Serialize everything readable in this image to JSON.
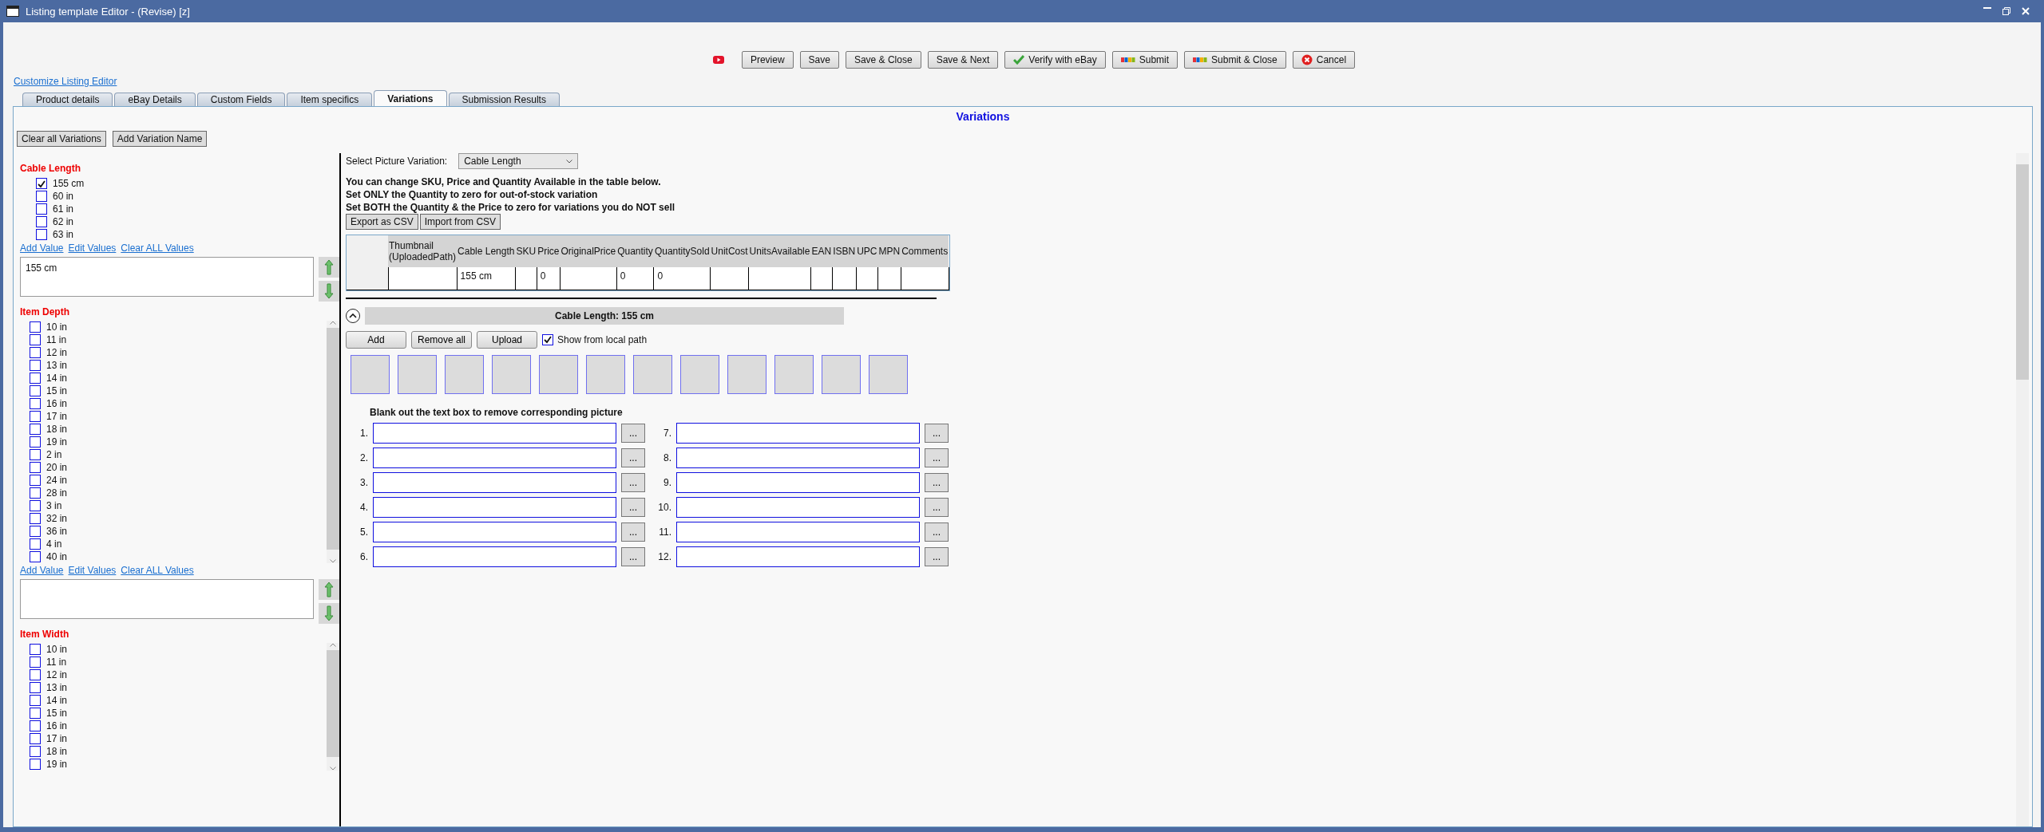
{
  "window": {
    "title": "Listing template Editor - (Revise) [z]"
  },
  "toolbar": [
    {
      "kind": "video"
    },
    {
      "kind": "plain",
      "label": "Preview"
    },
    {
      "kind": "plain",
      "label": "Save"
    },
    {
      "kind": "plain",
      "label": "Save & Close"
    },
    {
      "kind": "plain",
      "label": "Save & Next"
    },
    {
      "kind": "verify",
      "label": "Verify with eBay"
    },
    {
      "kind": "ebay",
      "label": "Submit"
    },
    {
      "kind": "ebay",
      "label": "Submit & Close"
    },
    {
      "kind": "cancel",
      "label": "Cancel"
    }
  ],
  "customize_link": "Customize Listing Editor",
  "tabs": [
    {
      "label": "Product details",
      "selected": false
    },
    {
      "label": "eBay Details",
      "selected": false
    },
    {
      "label": "Custom Fields",
      "selected": false
    },
    {
      "label": "Item specifics",
      "selected": false
    },
    {
      "label": "Variations",
      "selected": true
    },
    {
      "label": "Submission Results",
      "selected": false
    }
  ],
  "panel_title": "Variations",
  "variation_buttons": [
    "Clear all Variations",
    "Add Variation Name"
  ],
  "variations": [
    {
      "name": "Cable Length",
      "scrollable": false,
      "values": [
        {
          "label": "155 cm",
          "checked": true
        },
        {
          "label": "60 in",
          "checked": false
        },
        {
          "label": "61 in",
          "checked": false
        },
        {
          "label": "62 in",
          "checked": false
        },
        {
          "label": "63 in",
          "checked": false
        }
      ],
      "links": [
        "Add Value",
        "Edit Values",
        "Clear ALL Values"
      ],
      "editor_text": "155 cm"
    },
    {
      "name": "Item Depth",
      "scrollable": true,
      "values": [
        {
          "label": "10 in",
          "checked": false
        },
        {
          "label": "11 in",
          "checked": false
        },
        {
          "label": "12 in",
          "checked": false
        },
        {
          "label": "13 in",
          "checked": false
        },
        {
          "label": "14 in",
          "checked": false
        },
        {
          "label": "15 in",
          "checked": false
        },
        {
          "label": "16 in",
          "checked": false
        },
        {
          "label": "17 in",
          "checked": false
        },
        {
          "label": "18 in",
          "checked": false
        },
        {
          "label": "19 in",
          "checked": false
        },
        {
          "label": "2 in",
          "checked": false
        },
        {
          "label": "20 in",
          "checked": false
        },
        {
          "label": "24 in",
          "checked": false
        },
        {
          "label": "28 in",
          "checked": false
        },
        {
          "label": "3 in",
          "checked": false
        },
        {
          "label": "32 in",
          "checked": false
        },
        {
          "label": "36 in",
          "checked": false
        },
        {
          "label": "4 in",
          "checked": false
        },
        {
          "label": "40 in",
          "checked": false
        }
      ],
      "links": [
        "Add Value",
        "Edit Values",
        "Clear ALL Values"
      ]
    },
    {
      "name": "Item Width",
      "scrollable": true,
      "values": [
        {
          "label": "10 in",
          "checked": false
        },
        {
          "label": "11 in",
          "checked": false
        },
        {
          "label": "12 in",
          "checked": false
        },
        {
          "label": "13 in",
          "checked": false
        },
        {
          "label": "14 in",
          "checked": false
        },
        {
          "label": "15 in",
          "checked": false
        },
        {
          "label": "16 in",
          "checked": false
        },
        {
          "label": "17 in",
          "checked": false
        },
        {
          "label": "18 in",
          "checked": false
        },
        {
          "label": "19 in",
          "checked": false
        }
      ]
    }
  ],
  "picture_variation": {
    "label": "Select Picture Variation:",
    "value": "Cable Length"
  },
  "instructions": [
    "You can change SKU, Price and Quantity Available in the table below.",
    "Set ONLY the Quantity to zero for out-of-stock variation",
    "Set BOTH the Quantity & the Price to zero for variations you do NOT sell"
  ],
  "csv_buttons": [
    "Export as CSV",
    "Import from CSV"
  ],
  "table": {
    "columns": [
      "Thumbnail (UploadedPath)",
      "Cable Length",
      "SKU",
      "Price",
      "OriginalPrice",
      "Quantity",
      "QuantitySold",
      "UnitCost",
      "UnitsAvailable",
      "EAN",
      "ISBN",
      "UPC",
      "MPN",
      "Comments"
    ],
    "rows": [
      [
        "",
        "155 cm",
        "",
        "0",
        "",
        "0",
        "0",
        "",
        "",
        "",
        "",
        "",
        "",
        ""
      ]
    ]
  },
  "picture_group": {
    "title": "Cable Length: 155 cm",
    "expanded": true,
    "buttons": [
      "Add",
      "Remove all",
      "Upload"
    ],
    "local_path": {
      "label": "Show from local path",
      "checked": true
    },
    "hint": "Blank out the text box to remove corresponding picture",
    "slots": [
      {
        "number": "1.",
        "browse": "..."
      },
      {
        "number": "2.",
        "browse": "..."
      },
      {
        "number": "3.",
        "browse": "..."
      },
      {
        "number": "4.",
        "browse": "..."
      },
      {
        "number": "5.",
        "browse": "..."
      },
      {
        "number": "6.",
        "browse": "..."
      },
      {
        "number": "7.",
        "browse": "..."
      },
      {
        "number": "8.",
        "browse": "..."
      },
      {
        "number": "9.",
        "browse": "..."
      },
      {
        "number": "10.",
        "browse": "..."
      },
      {
        "number": "11.",
        "browse": "..."
      },
      {
        "number": "12.",
        "browse": "..."
      }
    ]
  }
}
